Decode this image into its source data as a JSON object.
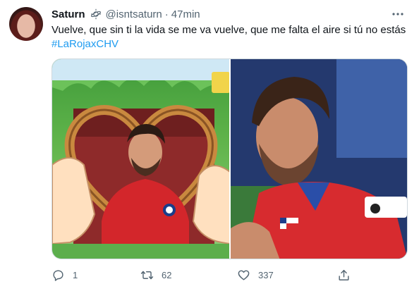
{
  "tweet": {
    "author_name": "Saturn",
    "handle": "@isntsaturn",
    "separator": "·",
    "time": "47min",
    "text": "Vuelve, que sin ti la vida se me va vuelve, que me falta el aire si tú no estás",
    "hashtag": "#LaRojaxCHV",
    "images": [
      {
        "description_icon": "heart-frame-player-photo"
      },
      {
        "description_icon": "player-in-red-jersey-photo"
      }
    ],
    "actions": {
      "reply_count": "1",
      "retweet_count": "62",
      "like_count": "337"
    },
    "colors": {
      "link": "#1d9bf0",
      "muted": "#536471",
      "text": "#0f1419"
    }
  }
}
